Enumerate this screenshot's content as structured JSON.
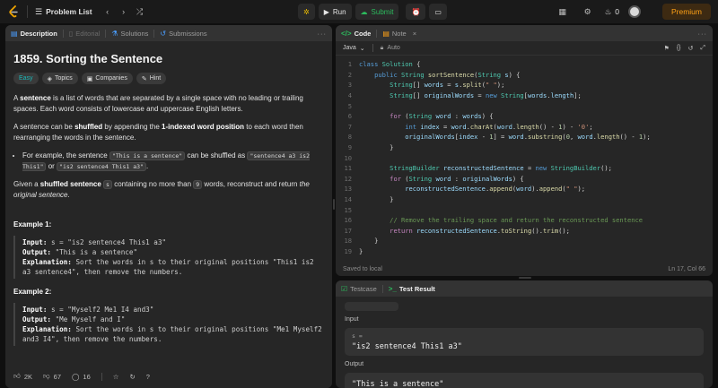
{
  "topbar": {
    "problem_list_label": "Problem List",
    "run_label": "Run",
    "submit_label": "Submit",
    "streak_count": "0",
    "premium_label": "Premium"
  },
  "description": {
    "tabs": [
      "Description",
      "Editorial",
      "Solutions",
      "Submissions"
    ],
    "title": "1859. Sorting the Sentence",
    "tags": [
      "Easy",
      "Topics",
      "Companies",
      "Hint"
    ],
    "p1_a": "A ",
    "p1_b": "sentence",
    "p1_c": " is a list of words that are separated by a single space with no leading or trailing spaces. Each word consists of lowercase and uppercase English letters.",
    "p2_a": "A sentence can be ",
    "p2_b": "shuffled",
    "p2_c": " by appending the ",
    "p2_d": "1-indexed word position",
    "p2_e": " to each word then rearranging the words in the sentence.",
    "bullet_a": "For example, the sentence ",
    "bullet_code1": "\"This is a sentence\"",
    "bullet_b": " can be shuffled as ",
    "bullet_code2": "\"sentence4 a3 is2 This1\"",
    "bullet_c": " or ",
    "bullet_code3": "\"is2 sentence4 This1 a3\"",
    "bullet_d": ".",
    "p3_a": "Given a ",
    "p3_b": "shuffled sentence",
    "p3_c": " ",
    "p3_code": "s",
    "p3_d": " containing no more than ",
    "p3_code2": "9",
    "p3_e": " words, reconstruct and return ",
    "p3_f": "the original sentence",
    "p3_g": ".",
    "example1_title": "Example 1:",
    "ex1_input_label": "Input:",
    "ex1_input": " s = \"is2 sentence4 This1 a3\"",
    "ex1_output_label": "Output:",
    "ex1_output": " \"This is a sentence\"",
    "ex1_expl_label": "Explanation:",
    "ex1_expl": " Sort the words in s to their original positions \"This1 is2 a3 sentence4\", then remove the numbers.",
    "example2_title": "Example 2:",
    "ex2_input_label": "Input:",
    "ex2_input": " s = \"Myself2 Me1 I4 and3\"",
    "ex2_output_label": "Output:",
    "ex2_output": " \"Me Myself and I\"",
    "ex2_expl_label": "Explanation:",
    "ex2_expl": " Sort the words in s to their original positions \"Me1 Myself2 and3 I4\", then remove the numbers.",
    "likes": "2K",
    "dislikes": "67",
    "comments": "16"
  },
  "code_panel": {
    "tabs": [
      "Code",
      "Note"
    ],
    "language": "Java",
    "autocomplete_label": "Auto",
    "status_left": "Saved to local",
    "status_right": "Ln 17, Col 66",
    "line_numbers": [
      "1",
      "2",
      "3",
      "4",
      "5",
      "6",
      "7",
      "8",
      "9",
      "10",
      "11",
      "12",
      "13",
      "14",
      "15",
      "16",
      "17",
      "18",
      "19"
    ]
  },
  "test_panel": {
    "tabs": [
      "Testcase",
      "Test Result"
    ],
    "input_label": "Input",
    "input_var": "s =",
    "input_value": "\"is2 sentence4 This1 a3\"",
    "output_label": "Output",
    "output_value": "\"This is a sentence\""
  },
  "colors": {
    "accent_orange": "#ffa116",
    "submit_green": "#2cbb5d",
    "easy_teal": "#1cb8b8"
  }
}
